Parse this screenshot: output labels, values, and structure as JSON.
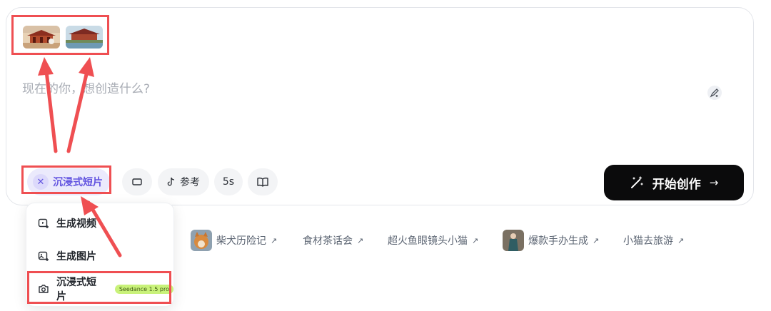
{
  "composer": {
    "placeholder": "现在的你，想创造什么?",
    "mode_chip_label": "沉浸式短片",
    "reference_label": "参考",
    "duration_label": "5s",
    "start_button_label": "开始创作"
  },
  "reference_images": [
    {
      "name": "reference-image-1",
      "description": "palace scene"
    },
    {
      "name": "reference-image-2",
      "description": "temple by water"
    }
  ],
  "mode_menu": {
    "items": [
      {
        "label": "生成视频",
        "icon": "video-add-icon"
      },
      {
        "label": "生成图片",
        "icon": "image-add-icon"
      },
      {
        "label": "沉浸式短片",
        "icon": "camera-icon",
        "badge": "Seedance 1.5 pro",
        "selected": true
      }
    ]
  },
  "suggestions": [
    {
      "label": "柴犬历险记",
      "has_thumb": true
    },
    {
      "label": "食材茶话会",
      "has_thumb": false
    },
    {
      "label": "超火鱼眼镜头小猫",
      "has_thumb": false
    },
    {
      "label": "爆款手办生成",
      "has_thumb": true
    },
    {
      "label": "小猫去旅游",
      "has_thumb": false
    }
  ],
  "colors": {
    "accent": "#6254e0",
    "annotation_red": "#ef4f52",
    "badge_green": "#c9f27a",
    "start_button_bg": "#0b0b0c"
  }
}
